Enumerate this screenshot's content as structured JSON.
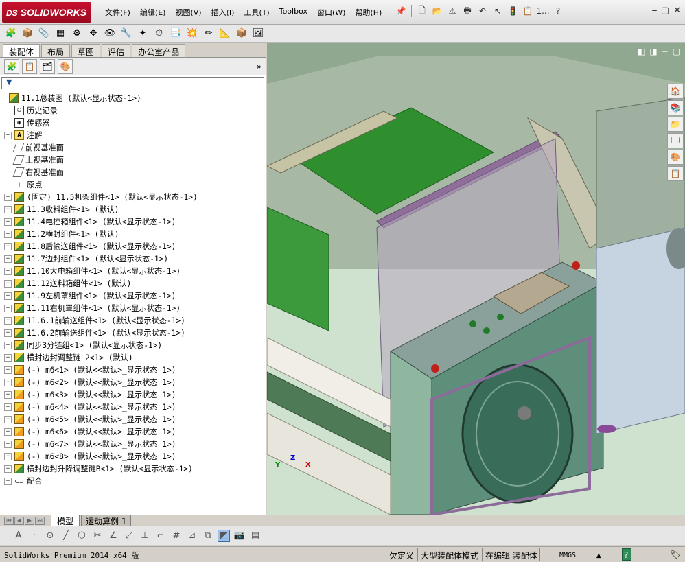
{
  "app": {
    "logo_prefix": "DS",
    "logo_text": "SOLIDWORKS",
    "menus": [
      "文件(F)",
      "编辑(E)",
      "视图(V)",
      "插入(I)",
      "工具(T)",
      "Toolbox",
      "窗口(W)",
      "帮助(H)"
    ],
    "title_overflow": "1...",
    "win_minimize": "⎯",
    "win_restore": "▢",
    "win_close": "✕"
  },
  "command_manager": {
    "tabs": [
      "装配体",
      "布局",
      "草图",
      "评估",
      "办公室产品"
    ],
    "active_tab": 0
  },
  "feature_manager": {
    "expand_label": "»",
    "filter_icon": "filter-icon",
    "tree": [
      {
        "label": "11.1总装图  (默认<显示状态-1>)",
        "icon": "assembly-icon",
        "expand": "",
        "top": true
      },
      {
        "label": "历史记录",
        "icon": "history-icon",
        "expand": ""
      },
      {
        "label": "传感器",
        "icon": "sensor-icon",
        "expand": ""
      },
      {
        "label": "注解",
        "icon": "annotation-icon",
        "expand": "+"
      },
      {
        "label": "前视基准面",
        "icon": "plane-icon",
        "expand": ""
      },
      {
        "label": "上视基准面",
        "icon": "plane-icon",
        "expand": ""
      },
      {
        "label": "右视基准面",
        "icon": "plane-icon",
        "expand": ""
      },
      {
        "label": "原点",
        "icon": "origin-icon",
        "expand": ""
      },
      {
        "label": "(固定) 11.5机架组件<1> (默认<显示状态-1>)",
        "icon": "subassembly-icon",
        "expand": "+"
      },
      {
        "label": "11.3收料组件<1> (默认)",
        "icon": "subassembly-icon",
        "expand": "+"
      },
      {
        "label": "11.4电控箱组件<1> (默认<显示状态-1>)",
        "icon": "subassembly-icon",
        "expand": "+"
      },
      {
        "label": "11.2横封组件<1> (默认)",
        "icon": "subassembly-icon",
        "expand": "+"
      },
      {
        "label": "11.8后输送组件<1> (默认<显示状态-1>)",
        "icon": "subassembly-icon",
        "expand": "+"
      },
      {
        "label": "11.7边封组件<1> (默认<显示状态-1>)",
        "icon": "subassembly-icon",
        "expand": "+"
      },
      {
        "label": "11.10大电箱组件<1> (默认<显示状态-1>)",
        "icon": "subassembly-icon",
        "expand": "+"
      },
      {
        "label": "11.12送料箱组件<1> (默认)",
        "icon": "subassembly-icon",
        "expand": "+"
      },
      {
        "label": "11.9左机罩组件<1> (默认<显示状态-1>)",
        "icon": "subassembly-icon",
        "expand": "+"
      },
      {
        "label": "11.11右机罩组件<1> (默认<显示状态-1>)",
        "icon": "subassembly-icon",
        "expand": "+"
      },
      {
        "label": "11.6.1前输送组件<1> (默认<显示状态-1>)",
        "icon": "subassembly-icon",
        "expand": "+"
      },
      {
        "label": "11.6.2前输送组件<1> (默认<显示状态-1>)",
        "icon": "subassembly-icon",
        "expand": "+"
      },
      {
        "label": "同步3分链组<1> (默认<显示状态-1>)",
        "icon": "subassembly-icon",
        "expand": "+"
      },
      {
        "label": "横封边封调整链_2<1> (默认)",
        "icon": "subassembly-icon",
        "expand": "+"
      },
      {
        "label": "(-) m6<1> (默认<<默认>_显示状态 1>)",
        "icon": "part-icon",
        "expand": "+"
      },
      {
        "label": "(-) m6<2> (默认<<默认>_显示状态 1>)",
        "icon": "part-icon",
        "expand": "+"
      },
      {
        "label": "(-) m6<3> (默认<<默认>_显示状态 1>)",
        "icon": "part-icon",
        "expand": "+"
      },
      {
        "label": "(-) m6<4> (默认<<默认>_显示状态 1>)",
        "icon": "part-icon",
        "expand": "+"
      },
      {
        "label": "(-) m6<5> (默认<<默认>_显示状态 1>)",
        "icon": "part-icon",
        "expand": "+"
      },
      {
        "label": "(-) m6<6> (默认<<默认>_显示状态 1>)",
        "icon": "part-icon",
        "expand": "+"
      },
      {
        "label": "(-) m6<7> (默认<<默认>_显示状态 1>)",
        "icon": "part-icon",
        "expand": "+"
      },
      {
        "label": "(-) m6<8> (默认<<默认>_显示状态 1>)",
        "icon": "part-icon",
        "expand": "+"
      },
      {
        "label": "横封边封升降调整链B<1> (默认<显示状态-1>)",
        "icon": "subassembly-icon",
        "expand": "+"
      },
      {
        "label": "配合",
        "icon": "mates-icon",
        "expand": "+"
      }
    ]
  },
  "bottom_tabs": {
    "model": "模型",
    "motion": "运动算例 1"
  },
  "status": {
    "version": "SolidWorks Premium 2014 x64 版",
    "underdefined": "欠定义",
    "mode": "大型装配体模式",
    "editing": "在编辑 装配体",
    "units": "MMGS",
    "units_caret": "▲",
    "help": "?"
  },
  "triad": {
    "x": "X",
    "y": "Y",
    "z": "Z"
  },
  "colors": {
    "brand": "#c8102e",
    "accent": "#2a6fbf"
  }
}
